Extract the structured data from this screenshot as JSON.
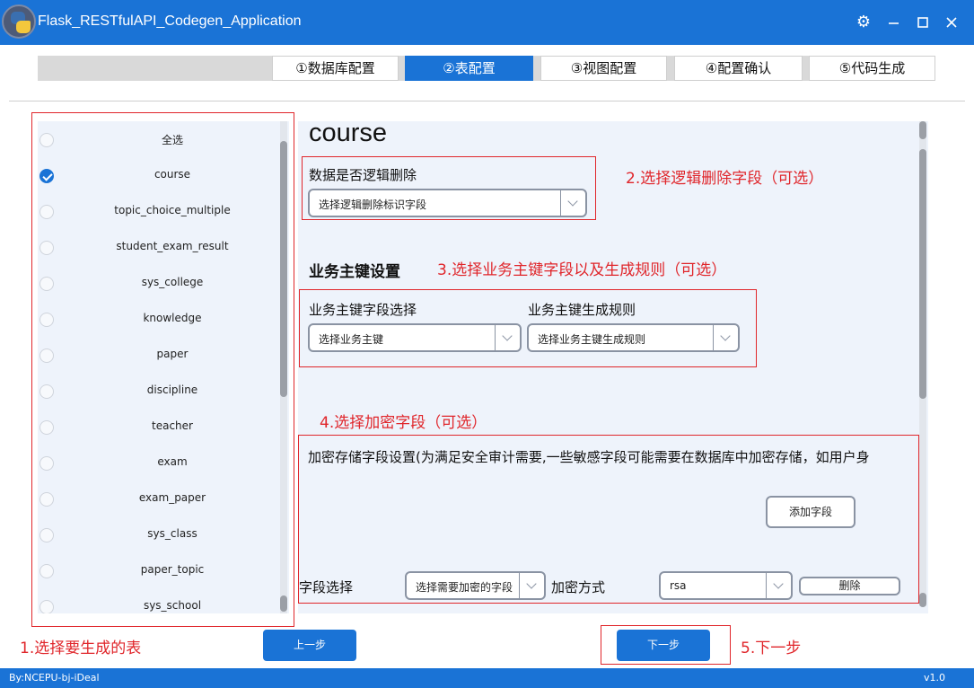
{
  "window": {
    "title": "Flask_RESTfulAPI_Codegen_Application"
  },
  "steps": [
    "①数据库配置",
    "②表配置",
    "③视图配置",
    "④配置确认",
    "⑤代码生成"
  ],
  "active_step": 1,
  "tables": {
    "items": [
      {
        "label": "全选",
        "checked": false
      },
      {
        "label": "course",
        "checked": true
      },
      {
        "label": "topic_choice_multiple",
        "checked": false
      },
      {
        "label": "student_exam_result",
        "checked": false
      },
      {
        "label": "sys_college",
        "checked": false
      },
      {
        "label": "knowledge",
        "checked": false
      },
      {
        "label": "paper",
        "checked": false
      },
      {
        "label": "discipline",
        "checked": false
      },
      {
        "label": "teacher",
        "checked": false
      },
      {
        "label": "exam",
        "checked": false
      },
      {
        "label": "exam_paper",
        "checked": false
      },
      {
        "label": "sys_class",
        "checked": false
      },
      {
        "label": "paper_topic",
        "checked": false
      },
      {
        "label": "sys_school",
        "checked": false
      }
    ]
  },
  "config": {
    "table_name": "course",
    "logic_delete": {
      "label": "数据是否逻辑删除",
      "select": "选择逻辑删除标识字段"
    },
    "business_key": {
      "title": "业务主键设置",
      "field_label": "业务主键字段选择",
      "field_select": "选择业务主键",
      "rule_label": "业务主键生成规则",
      "rule_select": "选择业务主键生成规则"
    },
    "encrypt": {
      "description": "加密存储字段设置(为满足安全审计需要,一些敏感字段可能需要在数据库中加密存储，如用户身",
      "add_button": "添加字段",
      "field_label": "字段选择",
      "field_select": "选择需要加密的字段",
      "method_label": "加密方式",
      "method_value": "rsa",
      "delete_button": "删除"
    }
  },
  "annotations": {
    "step1": "1.选择要生成的表",
    "step2": "2.选择逻辑删除字段（可选）",
    "step3": "3.选择业务主键字段以及生成规则（可选）",
    "step4": "4.选择加密字段（可选）",
    "step5": "5.下一步"
  },
  "nav": {
    "prev": "上一步",
    "next": "下一步"
  },
  "status": {
    "left": "By:NCEPU-bj-iDeal",
    "right": "v1.0"
  },
  "colors": {
    "accent": "#1a73d6",
    "annotation": "#e0262b",
    "panel_bg": "#eef3fb"
  },
  "icons": {
    "settings": "gear-icon",
    "minimize": "minimize-icon",
    "maximize": "maximize-icon",
    "close": "close-icon",
    "selected": "check-icon"
  }
}
